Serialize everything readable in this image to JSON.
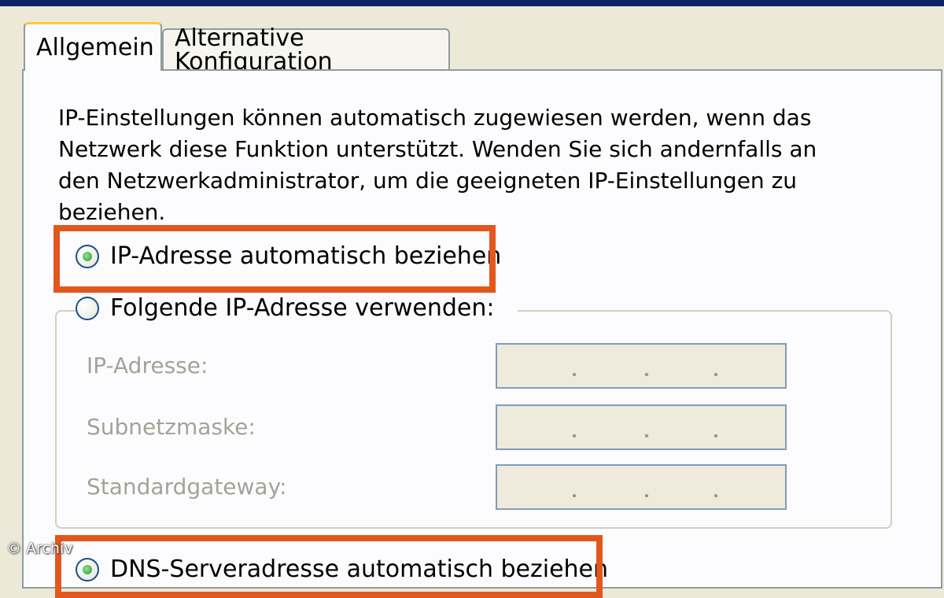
{
  "tabs": [
    {
      "label": "Allgemein",
      "active": true
    },
    {
      "label": "Alternative Konfiguration",
      "active": false
    }
  ],
  "description": "IP-Einstellungen können automatisch zugewiesen werden, wenn das Netzwerk diese Funktion unterstützt. Wenden Sie sich andernfalls an den Netzwerkadministrator, um die geeigneten IP-Einstellungen zu beziehen.",
  "ip_options": {
    "auto_label": "IP-Adresse automatisch beziehen",
    "auto_selected": true,
    "manual_label": "Folgende IP-Adresse verwenden:",
    "manual_selected": false
  },
  "fields": {
    "ip_address_label": "IP-Adresse:",
    "subnet_label": "Subnetzmaske:",
    "gateway_label": "Standardgateway:",
    "enabled": false
  },
  "dns_option": {
    "label": "DNS-Serveradresse automatisch beziehen",
    "selected": true
  },
  "watermark": "© Archiv",
  "colors": {
    "highlight": "#e2571e",
    "dialog_bg": "#ece9d8",
    "panel_bg": "#fcfcfe",
    "radio_checked": "#2a9a2a",
    "disabled_text": "#a3a39a"
  }
}
